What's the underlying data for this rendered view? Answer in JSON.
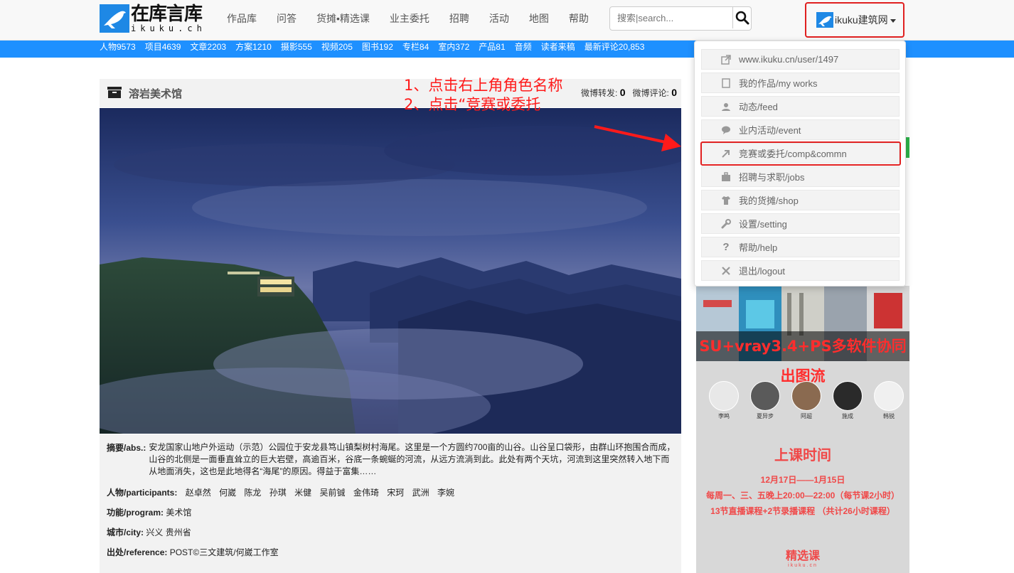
{
  "header": {
    "logo": {
      "cn": "在库言库",
      "en": "ikuku.ch"
    },
    "nav": [
      "作品库",
      "问答",
      "货摊•精选课",
      "业主委托",
      "招聘",
      "活动",
      "地图",
      "帮助"
    ],
    "search": {
      "placeholder": "搜索|search..."
    },
    "user": {
      "name": "ikuku建筑网"
    }
  },
  "stats_bar": [
    "人物9573",
    "项目4639",
    "文章2203",
    "方案1210",
    "摄影555",
    "视频205",
    "图书192",
    "专栏84",
    "室内372",
    "产品81",
    "音频",
    "读者来稿",
    "最新评论20,853"
  ],
  "article": {
    "title": "溶岩美术馆",
    "weibo_repost_label": "微博转发:",
    "weibo_repost_count": "0",
    "weibo_comment_label": "微博评论:",
    "weibo_comment_count": "0",
    "abstract_label": "摘要/abs.:",
    "abstract_text": "安龙国家山地户外运动（示范）公园位于安龙县笃山镇梨树村海尾。这里是一个方圆约700亩的山谷。山谷呈口袋形，由群山环抱围合而成，山谷的北侧是一面垂直耸立的巨大岩壁，高逾百米，谷底一条蜿蜒的河流，从远方流淌到此。此处有两个天坑，河流到这里突然转入地下而从地面消失，这也是此地得名“海尾”的原因。得益于富集……",
    "participants_label": "人物/participants:",
    "participants": [
      "赵卓然",
      "何崴",
      "陈龙",
      "孙琪",
      "米健",
      "吴前铖",
      "金伟琦",
      "宋珂",
      "武洲",
      "李婉"
    ],
    "program_label": "功能/program:",
    "program": "美术馆",
    "city_label": "城市/city:",
    "city": "兴义 贵州省",
    "reference_label": "出处/reference:",
    "reference": "POST©三文建筑/何崴工作室"
  },
  "annotations": {
    "step1": "1、点击右上角角色名称",
    "step2": "2、点击“竞赛或委托"
  },
  "dropdown": [
    {
      "icon": "external-link-icon",
      "label": "www.ikuku.cn/user/1497"
    },
    {
      "icon": "works-icon",
      "label": "我的作品/my works"
    },
    {
      "icon": "feed-icon",
      "label": "动态/feed"
    },
    {
      "icon": "chat-bubble-icon",
      "label": "业内活动/event"
    },
    {
      "icon": "arrow-up-right-icon",
      "label": "竞赛或委托/comp&commn"
    },
    {
      "icon": "briefcase-icon",
      "label": "招聘与求职/jobs"
    },
    {
      "icon": "shirt-icon",
      "label": "我的货摊/shop"
    },
    {
      "icon": "wrench-icon",
      "label": "设置/setting"
    },
    {
      "icon": "question-icon",
      "label": "帮助/help"
    },
    {
      "icon": "close-icon",
      "label": "退出/logout"
    }
  ],
  "sidebar_ad": {
    "banner": "SU+vray3.4+PS多软件协同出图流",
    "teachers": [
      "李鸣",
      "夏异步",
      "阿超",
      "施成",
      "韩锐"
    ],
    "class_title": "上课时间",
    "line1": "12月17日——1月15日",
    "line2": "每周一、三、五晚上20:00—22:00（每节课2小时）",
    "line3": "13节直播课程+2节录播课程 （共计26小时课程）",
    "footer_label": "精选课",
    "footer_sub": "ikuku.cn"
  },
  "colors": {
    "accent_blue": "#1e90ff",
    "annotation_red": "#ff1a1a",
    "ad_red": "#f04848"
  }
}
